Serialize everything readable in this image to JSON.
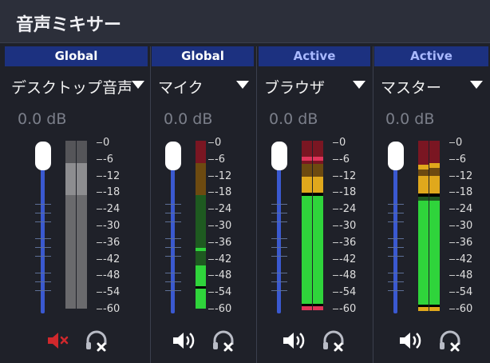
{
  "window": {
    "title": "音声ミキサー"
  },
  "scale_labels": [
    "0",
    "-6",
    "-12",
    "-18",
    "-24",
    "-30",
    "-36",
    "-42",
    "-48",
    "-54",
    "-60"
  ],
  "colors": {
    "badge_bg": "#1c3180",
    "slider_track": "#3a59d0",
    "meter_green": "#2fd43b",
    "meter_yellow": "#e0a81c",
    "meter_red": "#e0345a",
    "muted_icon": "#d0282c"
  },
  "mixers": [
    {
      "badge": "Global",
      "source": "デスクトップ音声",
      "volume": "0.0 dB",
      "muted": true,
      "icons": {
        "speaker": "speaker-muted-icon",
        "monitor": "headphones-off-icon"
      }
    },
    {
      "badge": "Global",
      "source": "マイク",
      "volume": "0.0 dB",
      "muted": false,
      "icons": {
        "speaker": "speaker-icon",
        "monitor": "headphones-off-icon"
      }
    },
    {
      "badge": "Active",
      "source": "ブラウザ",
      "volume": "0.0 dB",
      "muted": false,
      "icons": {
        "speaker": "speaker-icon",
        "monitor": "headphones-off-icon"
      }
    },
    {
      "badge": "Active",
      "source": "マスター",
      "volume": "0.0 dB",
      "muted": false,
      "icons": {
        "speaker": "speaker-icon",
        "monitor": "headphones-off-icon"
      }
    }
  ]
}
